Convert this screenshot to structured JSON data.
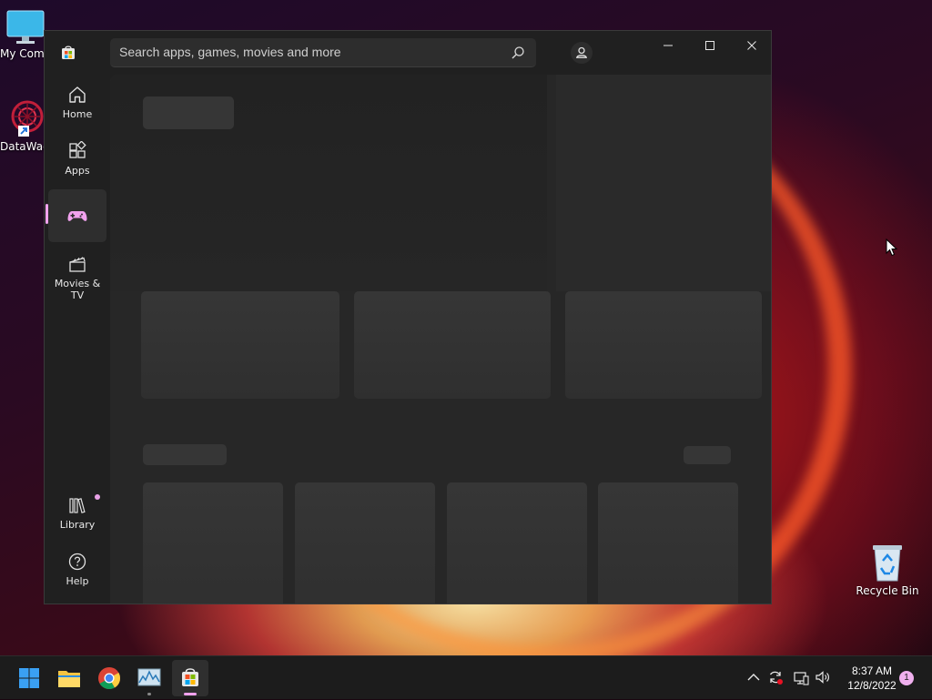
{
  "desktop": {
    "icons": [
      {
        "label": "My Com"
      },
      {
        "label": "DataWag"
      },
      {
        "label": "Recycle Bin"
      }
    ]
  },
  "store": {
    "search": {
      "placeholder": "Search apps, games, movies and more",
      "value": ""
    },
    "nav": [
      {
        "label": "Home",
        "icon": "home-icon"
      },
      {
        "label": "Apps",
        "icon": "apps-icon"
      },
      {
        "label": "",
        "icon": "gamepad-icon",
        "active": true
      },
      {
        "label": "Movies & TV",
        "icon": "movies-icon"
      }
    ],
    "nav_bottom": [
      {
        "label": "Library",
        "icon": "library-icon",
        "badge": true
      },
      {
        "label": "Help",
        "icon": "help-icon"
      }
    ],
    "loading": true
  },
  "taskbar": {
    "apps": [
      "start-icon",
      "file-explorer-icon",
      "chrome-icon",
      "task-manager-icon",
      "microsoft-store-icon"
    ],
    "tray": [
      "chevron-up-icon",
      "sync-icon",
      "network-icon",
      "volume-icon"
    ],
    "time": "8:37 AM",
    "date": "12/8/2022",
    "notifications": "1"
  },
  "colors": {
    "accent": "#f1a2ee",
    "window_bg": "#202020",
    "content_bg": "#272727",
    "skeleton": "#363636"
  }
}
